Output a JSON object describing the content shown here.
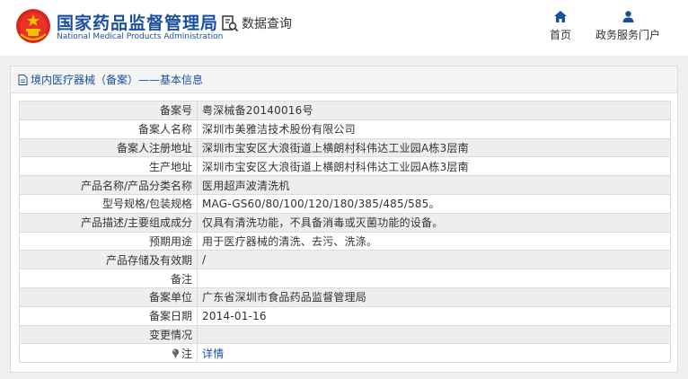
{
  "header": {
    "brand_cn": "国家药品监督管理局",
    "brand_en": "National Medical Products Administration",
    "query_label": "数据查询",
    "nav": {
      "home": "首页",
      "service": "政务服务门户"
    }
  },
  "panel": {
    "title": "境内医疗器械（备案）——基本信息",
    "rows": [
      {
        "label": "备案号",
        "value": "粤深械备20140016号"
      },
      {
        "label": "备案人名称",
        "value": "深圳市美雅洁技术股份有限公司"
      },
      {
        "label": "备案人注册地址",
        "value": "深圳市宝安区大浪街道上横朗村科伟达工业园A栋3层南"
      },
      {
        "label": "生产地址",
        "value": "深圳市宝安区大浪街道上横朗村科伟达工业园A栋3层南"
      },
      {
        "label": "产品名称/产品分类名称",
        "value": "医用超声波清洗机"
      },
      {
        "label": "型号规格/包装规格",
        "value": "MAG-GS60/80/100/120/180/385/485/585。"
      },
      {
        "label": "产品描述/主要组成成分",
        "value": "仅具有清洗功能，不具备消毒或灭菌功能的设备。"
      },
      {
        "label": "预期用途",
        "value": "用于医疗器械的清洗、去污、洗涤。"
      },
      {
        "label": "产品存储及有效期",
        "value": "/"
      },
      {
        "label": "备注",
        "value": ""
      },
      {
        "label": "备案单位",
        "value": "广东省深圳市食品药品监督管理局"
      },
      {
        "label": "备案日期",
        "value": "2014-01-16"
      },
      {
        "label": "变更情况",
        "value": ""
      }
    ],
    "note": {
      "label": "注",
      "link": "详情"
    }
  },
  "colors": {
    "brand_blue": "#1a4fa0",
    "emblem_red": "#d7261e",
    "emblem_gold": "#f2c200"
  },
  "icons": [
    "national-emblem-icon",
    "search-document-icon",
    "home-icon",
    "user-icon",
    "document-icon",
    "pin-icon"
  ]
}
